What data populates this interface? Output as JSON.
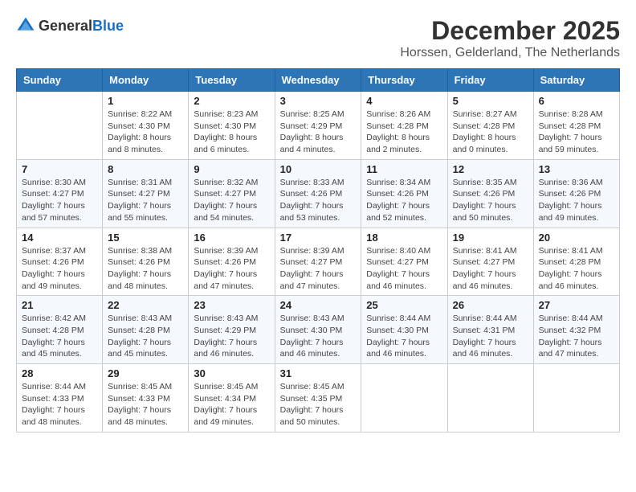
{
  "header": {
    "logo_general": "General",
    "logo_blue": "Blue",
    "month_title": "December 2025",
    "location": "Horssen, Gelderland, The Netherlands"
  },
  "days_of_week": [
    "Sunday",
    "Monday",
    "Tuesday",
    "Wednesday",
    "Thursday",
    "Friday",
    "Saturday"
  ],
  "weeks": [
    [
      {
        "day": "",
        "sunrise": "",
        "sunset": "",
        "daylight": ""
      },
      {
        "day": "1",
        "sunrise": "Sunrise: 8:22 AM",
        "sunset": "Sunset: 4:30 PM",
        "daylight": "Daylight: 8 hours and 8 minutes."
      },
      {
        "day": "2",
        "sunrise": "Sunrise: 8:23 AM",
        "sunset": "Sunset: 4:30 PM",
        "daylight": "Daylight: 8 hours and 6 minutes."
      },
      {
        "day": "3",
        "sunrise": "Sunrise: 8:25 AM",
        "sunset": "Sunset: 4:29 PM",
        "daylight": "Daylight: 8 hours and 4 minutes."
      },
      {
        "day": "4",
        "sunrise": "Sunrise: 8:26 AM",
        "sunset": "Sunset: 4:28 PM",
        "daylight": "Daylight: 8 hours and 2 minutes."
      },
      {
        "day": "5",
        "sunrise": "Sunrise: 8:27 AM",
        "sunset": "Sunset: 4:28 PM",
        "daylight": "Daylight: 8 hours and 0 minutes."
      },
      {
        "day": "6",
        "sunrise": "Sunrise: 8:28 AM",
        "sunset": "Sunset: 4:28 PM",
        "daylight": "Daylight: 7 hours and 59 minutes."
      }
    ],
    [
      {
        "day": "7",
        "sunrise": "Sunrise: 8:30 AM",
        "sunset": "Sunset: 4:27 PM",
        "daylight": "Daylight: 7 hours and 57 minutes."
      },
      {
        "day": "8",
        "sunrise": "Sunrise: 8:31 AM",
        "sunset": "Sunset: 4:27 PM",
        "daylight": "Daylight: 7 hours and 55 minutes."
      },
      {
        "day": "9",
        "sunrise": "Sunrise: 8:32 AM",
        "sunset": "Sunset: 4:27 PM",
        "daylight": "Daylight: 7 hours and 54 minutes."
      },
      {
        "day": "10",
        "sunrise": "Sunrise: 8:33 AM",
        "sunset": "Sunset: 4:26 PM",
        "daylight": "Daylight: 7 hours and 53 minutes."
      },
      {
        "day": "11",
        "sunrise": "Sunrise: 8:34 AM",
        "sunset": "Sunset: 4:26 PM",
        "daylight": "Daylight: 7 hours and 52 minutes."
      },
      {
        "day": "12",
        "sunrise": "Sunrise: 8:35 AM",
        "sunset": "Sunset: 4:26 PM",
        "daylight": "Daylight: 7 hours and 50 minutes."
      },
      {
        "day": "13",
        "sunrise": "Sunrise: 8:36 AM",
        "sunset": "Sunset: 4:26 PM",
        "daylight": "Daylight: 7 hours and 49 minutes."
      }
    ],
    [
      {
        "day": "14",
        "sunrise": "Sunrise: 8:37 AM",
        "sunset": "Sunset: 4:26 PM",
        "daylight": "Daylight: 7 hours and 49 minutes."
      },
      {
        "day": "15",
        "sunrise": "Sunrise: 8:38 AM",
        "sunset": "Sunset: 4:26 PM",
        "daylight": "Daylight: 7 hours and 48 minutes."
      },
      {
        "day": "16",
        "sunrise": "Sunrise: 8:39 AM",
        "sunset": "Sunset: 4:26 PM",
        "daylight": "Daylight: 7 hours and 47 minutes."
      },
      {
        "day": "17",
        "sunrise": "Sunrise: 8:39 AM",
        "sunset": "Sunset: 4:27 PM",
        "daylight": "Daylight: 7 hours and 47 minutes."
      },
      {
        "day": "18",
        "sunrise": "Sunrise: 8:40 AM",
        "sunset": "Sunset: 4:27 PM",
        "daylight": "Daylight: 7 hours and 46 minutes."
      },
      {
        "day": "19",
        "sunrise": "Sunrise: 8:41 AM",
        "sunset": "Sunset: 4:27 PM",
        "daylight": "Daylight: 7 hours and 46 minutes."
      },
      {
        "day": "20",
        "sunrise": "Sunrise: 8:41 AM",
        "sunset": "Sunset: 4:28 PM",
        "daylight": "Daylight: 7 hours and 46 minutes."
      }
    ],
    [
      {
        "day": "21",
        "sunrise": "Sunrise: 8:42 AM",
        "sunset": "Sunset: 4:28 PM",
        "daylight": "Daylight: 7 hours and 45 minutes."
      },
      {
        "day": "22",
        "sunrise": "Sunrise: 8:43 AM",
        "sunset": "Sunset: 4:28 PM",
        "daylight": "Daylight: 7 hours and 45 minutes."
      },
      {
        "day": "23",
        "sunrise": "Sunrise: 8:43 AM",
        "sunset": "Sunset: 4:29 PM",
        "daylight": "Daylight: 7 hours and 46 minutes."
      },
      {
        "day": "24",
        "sunrise": "Sunrise: 8:43 AM",
        "sunset": "Sunset: 4:30 PM",
        "daylight": "Daylight: 7 hours and 46 minutes."
      },
      {
        "day": "25",
        "sunrise": "Sunrise: 8:44 AM",
        "sunset": "Sunset: 4:30 PM",
        "daylight": "Daylight: 7 hours and 46 minutes."
      },
      {
        "day": "26",
        "sunrise": "Sunrise: 8:44 AM",
        "sunset": "Sunset: 4:31 PM",
        "daylight": "Daylight: 7 hours and 46 minutes."
      },
      {
        "day": "27",
        "sunrise": "Sunrise: 8:44 AM",
        "sunset": "Sunset: 4:32 PM",
        "daylight": "Daylight: 7 hours and 47 minutes."
      }
    ],
    [
      {
        "day": "28",
        "sunrise": "Sunrise: 8:44 AM",
        "sunset": "Sunset: 4:33 PM",
        "daylight": "Daylight: 7 hours and 48 minutes."
      },
      {
        "day": "29",
        "sunrise": "Sunrise: 8:45 AM",
        "sunset": "Sunset: 4:33 PM",
        "daylight": "Daylight: 7 hours and 48 minutes."
      },
      {
        "day": "30",
        "sunrise": "Sunrise: 8:45 AM",
        "sunset": "Sunset: 4:34 PM",
        "daylight": "Daylight: 7 hours and 49 minutes."
      },
      {
        "day": "31",
        "sunrise": "Sunrise: 8:45 AM",
        "sunset": "Sunset: 4:35 PM",
        "daylight": "Daylight: 7 hours and 50 minutes."
      },
      {
        "day": "",
        "sunrise": "",
        "sunset": "",
        "daylight": ""
      },
      {
        "day": "",
        "sunrise": "",
        "sunset": "",
        "daylight": ""
      },
      {
        "day": "",
        "sunrise": "",
        "sunset": "",
        "daylight": ""
      }
    ]
  ]
}
